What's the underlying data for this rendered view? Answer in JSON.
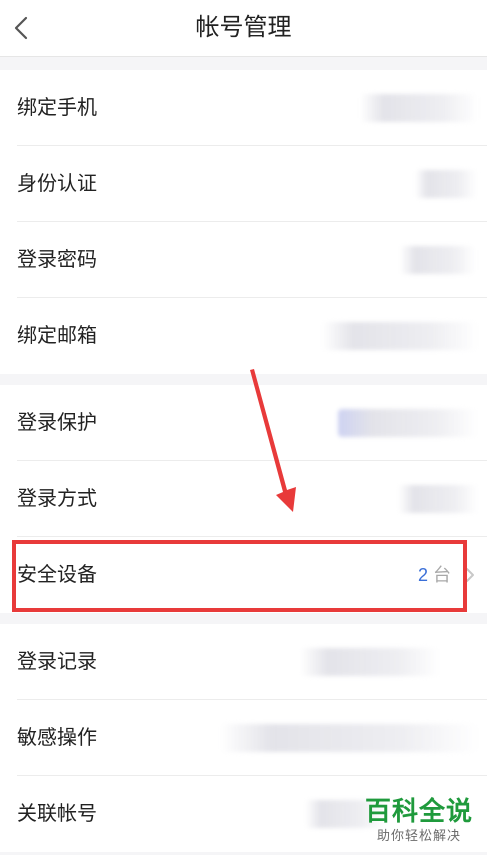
{
  "header": {
    "title": "帐号管理",
    "back_icon": "chevron-left-icon"
  },
  "groups": [
    {
      "items": [
        {
          "label": "绑定手机"
        },
        {
          "label": "身份认证"
        },
        {
          "label": "登录密码"
        },
        {
          "label": "绑定邮箱"
        }
      ]
    },
    {
      "items": [
        {
          "label": "登录保护"
        },
        {
          "label": "登录方式"
        },
        {
          "label": "安全设备",
          "count": "2",
          "unit": "台"
        }
      ]
    },
    {
      "items": [
        {
          "label": "登录记录"
        },
        {
          "label": "敏感操作"
        },
        {
          "label": "关联帐号"
        }
      ]
    }
  ],
  "annotation": {
    "highlight_color": "#e83a3a",
    "arrow_color": "#e83a3a"
  },
  "watermark": {
    "title": "百科全说",
    "subtitle": "助你轻松解决"
  },
  "colors": {
    "accent": "#3a6fd8",
    "watermark_green": "#1f9a3c"
  }
}
